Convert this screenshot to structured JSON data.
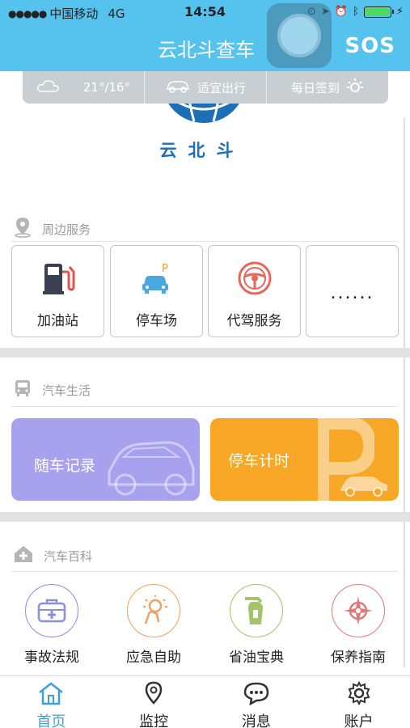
{
  "status_bar": {
    "carrier": "中国移动",
    "network": "4G",
    "time": "14:54"
  },
  "header": {
    "title": "云北斗查车",
    "sos_label": "SOS"
  },
  "info_bar": {
    "weather": "21°/16°",
    "travel": "适宜出行",
    "checkin": "每日签到"
  },
  "logo": {
    "text": "云北斗"
  },
  "nearby": {
    "title": "周边服务",
    "tiles": [
      {
        "label": "加油站",
        "icon": "gas-station-icon"
      },
      {
        "label": "停车场",
        "icon": "parking-car-icon"
      },
      {
        "label": "代驾服务",
        "icon": "steering-wheel-icon"
      },
      {
        "label": "......",
        "icon": "more-icon"
      }
    ]
  },
  "life": {
    "title": "汽车生活",
    "cards": [
      {
        "label": "随车记录",
        "color": "#a8a2ee"
      },
      {
        "label": "停车计时",
        "color": "#f8a626"
      }
    ]
  },
  "encyclopedia": {
    "title": "汽车百科",
    "items": [
      {
        "label": "事故法规",
        "icon": "first-aid-kit-icon",
        "color": "#8a8fe0"
      },
      {
        "label": "应急自助",
        "icon": "idea-hand-icon",
        "color": "#f0a060"
      },
      {
        "label": "省油宝典",
        "icon": "fuel-nozzle-icon",
        "color": "#a3c46b"
      },
      {
        "label": "保养指南",
        "icon": "compass-icon",
        "color": "#e07a7a"
      }
    ]
  },
  "tabbar": {
    "tabs": [
      {
        "label": "首页",
        "icon": "home-icon",
        "active": true
      },
      {
        "label": "监控",
        "icon": "location-pin-icon",
        "active": false
      },
      {
        "label": "消息",
        "icon": "chat-bubble-icon",
        "active": false
      },
      {
        "label": "账户",
        "icon": "gear-icon",
        "active": false
      }
    ]
  },
  "colors": {
    "header": "#56c3ef",
    "active_tab": "#3aa0d8"
  }
}
